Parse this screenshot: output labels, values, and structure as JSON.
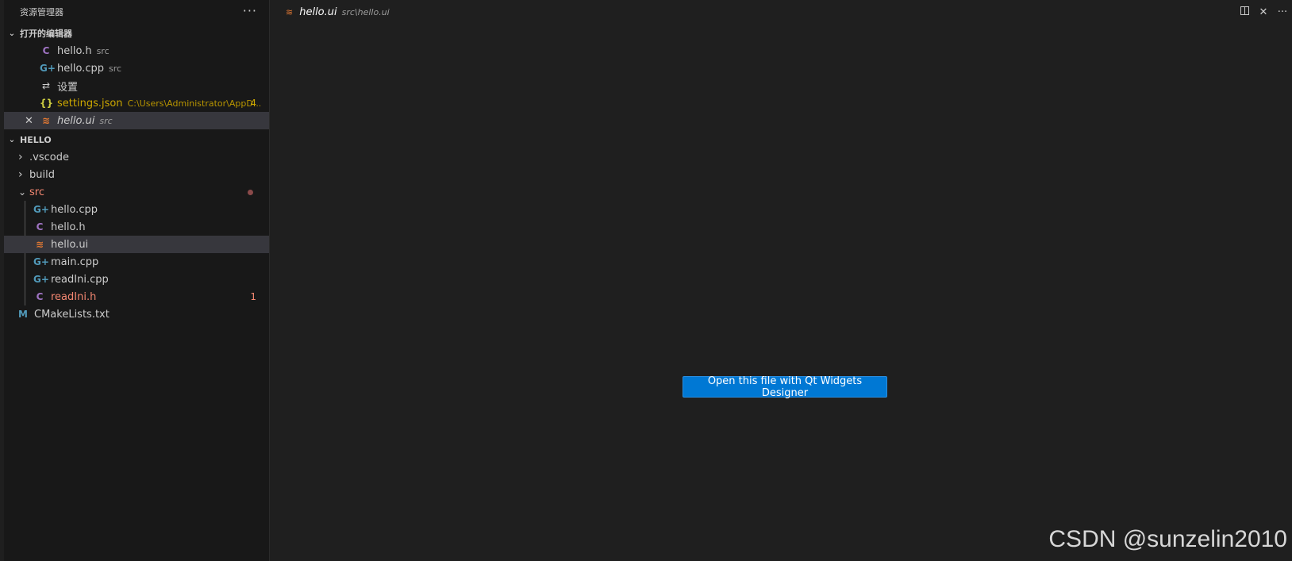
{
  "sidebar": {
    "title": "资源管理器",
    "more_label": "···",
    "open_editors": {
      "title": "打开的编辑器",
      "items": [
        {
          "icon": "C",
          "icon_name": "c-header-icon",
          "name": "hello.h",
          "desc": "src",
          "badge": ""
        },
        {
          "icon": "G+",
          "icon_name": "cpp-file-icon",
          "name": "hello.cpp",
          "desc": "src",
          "badge": ""
        },
        {
          "icon": "⇄",
          "icon_name": "settings-icon",
          "name": "设置",
          "desc": "",
          "badge": ""
        },
        {
          "icon": "{}",
          "icon_name": "json-icon",
          "name": "settings.json",
          "desc": "C:\\Users\\Administrator\\AppD...",
          "badge": "4"
        },
        {
          "icon": "≋",
          "icon_name": "ui-file-icon",
          "name": "hello.ui",
          "desc": "src",
          "badge": "",
          "close": "✕"
        }
      ]
    },
    "workspace": {
      "title": "HELLO",
      "folders": [
        {
          "name": ".vscode",
          "chev": "›"
        },
        {
          "name": "build",
          "chev": "›"
        },
        {
          "name": "src",
          "chev": "⌄"
        }
      ],
      "src_files": [
        {
          "icon": "G+",
          "name": "hello.cpp",
          "badge": ""
        },
        {
          "icon": "C",
          "name": "hello.h",
          "badge": ""
        },
        {
          "icon": "≋",
          "name": "hello.ui",
          "badge": ""
        },
        {
          "icon": "G+",
          "name": "main.cpp",
          "badge": ""
        },
        {
          "icon": "G+",
          "name": "readIni.cpp",
          "badge": ""
        },
        {
          "icon": "C",
          "name": "readIni.h",
          "badge": "1"
        }
      ],
      "root_files": [
        {
          "icon": "M",
          "name": "CMakeLists.txt"
        }
      ]
    }
  },
  "tab": {
    "title": "hello.ui",
    "path": "src\\hello.ui",
    "icon": "≋"
  },
  "actions": {
    "close_label": "✕",
    "more_label": "···"
  },
  "editor": {
    "button_label": "Open this file with Qt Widgets Designer"
  },
  "watermark": "CSDN @sunzelin2010",
  "colors": {
    "accent": "#0078d4",
    "error": "#f48771",
    "warning": "#cca700"
  }
}
